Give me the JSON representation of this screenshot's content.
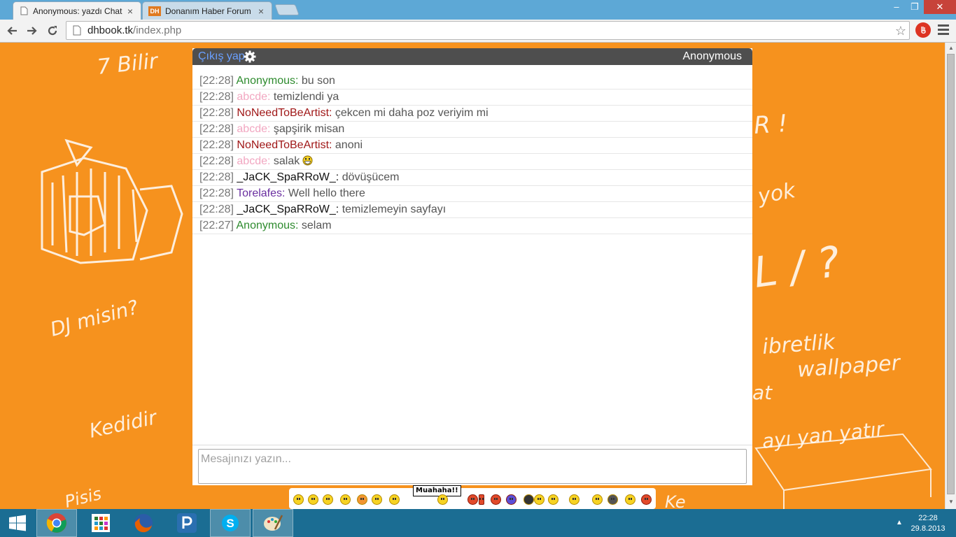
{
  "browser": {
    "tabs": [
      {
        "title": "Anonymous: yazdı Chat U",
        "active": true
      },
      {
        "title": "Donanım Haber Forum",
        "active": false,
        "favicon_text": "DH"
      }
    ],
    "address": {
      "host": "dhbook.tk",
      "path": "/index.php"
    }
  },
  "wallpaper": {
    "texts": [
      "7 Bilir",
      "DJ misin?",
      "Kedidir",
      "yok",
      "ibretlik",
      "wallpaper",
      "ayı yan yatır",
      "R !",
      "L / ?",
      "at",
      "Ke",
      "Pisis"
    ]
  },
  "chat": {
    "logout_label": "Çıkış yap",
    "username": "Anonymous",
    "messages": [
      {
        "time": "[22:28]",
        "author": "Anonymous:",
        "author_color": "#2e8b2e",
        "text": "bu son"
      },
      {
        "time": "[22:28]",
        "author": "abcde:",
        "author_color": "#f2a7c1",
        "text": "temizlendi ya"
      },
      {
        "time": "[22:28]",
        "author": "NoNeedToBeArtist:",
        "author_color": "#a01818",
        "text": "çekcen mi daha poz veriyim mi"
      },
      {
        "time": "[22:28]",
        "author": "abcde:",
        "author_color": "#f2a7c1",
        "text": "şapşirik misan"
      },
      {
        "time": "[22:28]",
        "author": "NoNeedToBeArtist:",
        "author_color": "#a01818",
        "text": "anoni"
      },
      {
        "time": "[22:28]",
        "author": "abcde:",
        "author_color": "#f2a7c1",
        "text": "salak",
        "smiley": "laughing-icon"
      },
      {
        "time": "[22:28]",
        "author": "_JaCK_SpaRRoW_:",
        "author_color": "#111111",
        "text": "dövüşücem"
      },
      {
        "time": "[22:28]",
        "author": "Torelafes:",
        "author_color": "#6a2fa0",
        "text": "Well hello there"
      },
      {
        "time": "[22:28]",
        "author": "_JaCK_SpaRRoW_:",
        "author_color": "#111111",
        "text": "temizlemeyin sayfayı"
      },
      {
        "time": "[22:27]",
        "author": "Anonymous:",
        "author_color": "#2e8b2e",
        "text": "selam"
      }
    ],
    "input_placeholder": "Mesajınızı yazın...",
    "emoji_sign_text": "Muahaha!!"
  },
  "taskbar": {
    "time": "22:28",
    "date": "29.8.2013"
  }
}
